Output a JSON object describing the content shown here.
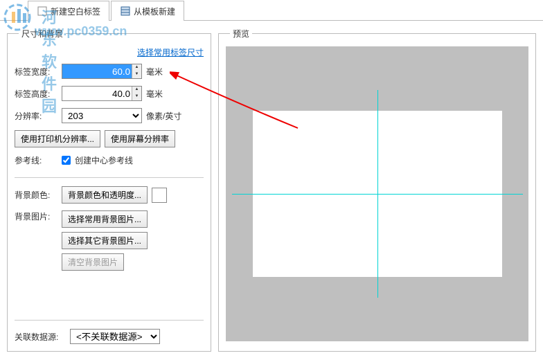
{
  "watermark": {
    "text1": "河东软件园",
    "text2": "www.pc0359.cn"
  },
  "tabs": {
    "new_blank": "新建空白标签",
    "new_template": "从模板新建"
  },
  "left": {
    "legend": "尺寸和背景",
    "link": "选择常用标签尺寸",
    "width_label": "标签宽度:",
    "width_value": "60.0",
    "width_unit": "毫米",
    "height_label": "标签高度:",
    "height_value": "40.0",
    "height_unit": "毫米",
    "dpi_label": "分辨率:",
    "dpi_value": "203",
    "dpi_unit": "像素/英寸",
    "btn_printer_dpi": "使用打印机分辨率...",
    "btn_screen_dpi": "使用屏幕分辨率",
    "guide_label": "参考线:",
    "guide_cb": "创建中心参考线",
    "bgcolor_label": "背景颜色:",
    "bgcolor_btn": "背景颜色和透明度...",
    "bgimg_label": "背景图片:",
    "bgimg_btn1": "选择常用背景图片...",
    "bgimg_btn2": "选择其它背景图片...",
    "bgimg_btn3": "清空背景图片",
    "ds_label": "关联数据源:",
    "ds_value": "<不关联数据源>"
  },
  "right": {
    "legend": "预览"
  }
}
